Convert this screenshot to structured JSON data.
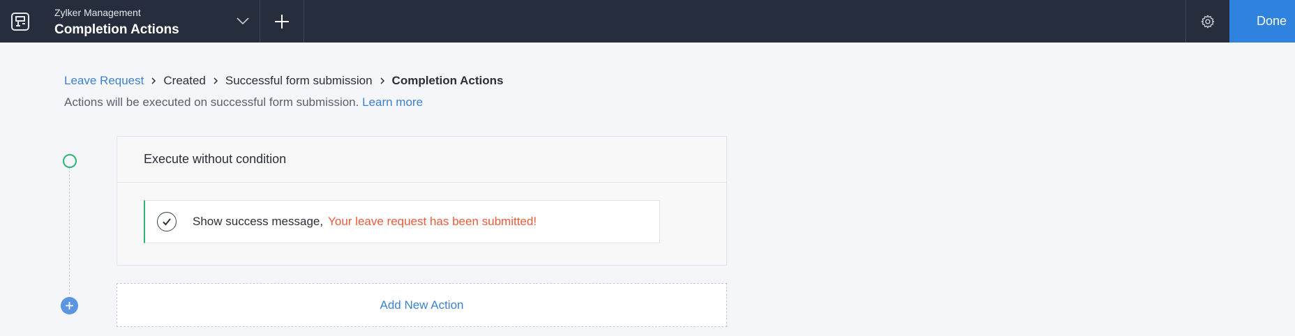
{
  "header": {
    "app_name": "Zylker Management",
    "page_name": "Completion Actions",
    "done_label": "Done",
    "icons": {
      "app": "app-switcher-icon",
      "dropdown": "chevron-down-icon",
      "add": "plus-icon",
      "settings": "gear-icon"
    }
  },
  "breadcrumb": {
    "items": [
      "Leave Request",
      "Created",
      "Successful form submission",
      "Completion Actions"
    ],
    "separator_icon": "chevron-right-icon"
  },
  "subtitle": {
    "text": "Actions will be executed on successful form submission.",
    "link_label": "Learn more"
  },
  "condition": {
    "title": "Execute without condition",
    "action": {
      "label": "Show success message,",
      "value": "Your leave request has been submitted!",
      "icon": "check-circle-icon"
    }
  },
  "add_action": {
    "label": "Add New Action",
    "icon": "plus-circle-icon"
  },
  "colors": {
    "topbar": "#262d3d",
    "accent": "#2f83de",
    "link": "#3d81cf",
    "success": "#2bb673",
    "message": "#ea5b3a"
  }
}
